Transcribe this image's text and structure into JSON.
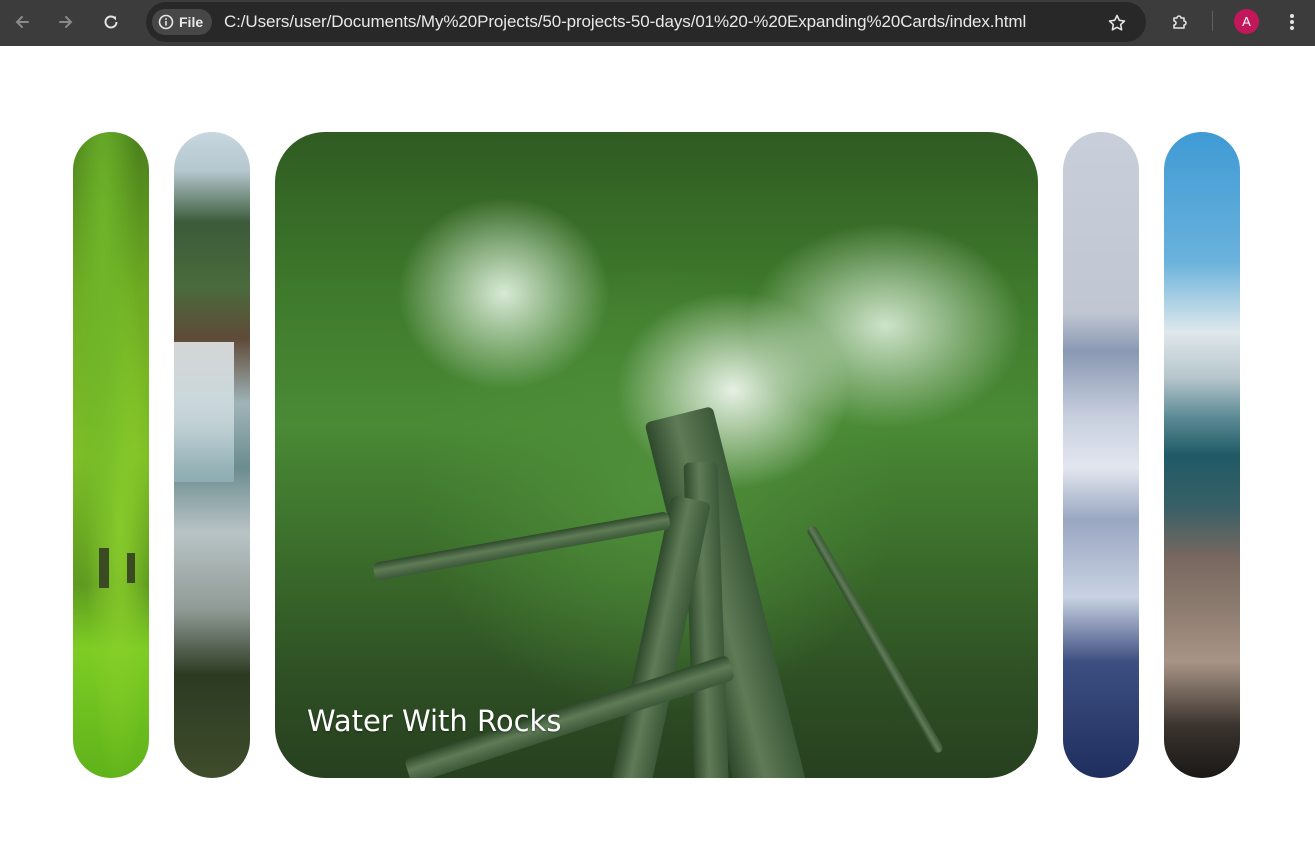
{
  "browser": {
    "file_label": "File",
    "url": "C:/Users/user/Documents/My%20Projects/50-projects-50-days/01%20-%20Expanding%20Cards/index.html",
    "avatar_initial": "A",
    "avatar_color": "#c2185b"
  },
  "panels": [
    {
      "title": "",
      "image": "green-trees",
      "active": false
    },
    {
      "title": "",
      "image": "waterfall",
      "active": false
    },
    {
      "title": "Water With Rocks",
      "image": "bamboo-forest",
      "active": true
    },
    {
      "title": "",
      "image": "snowy-mountain",
      "active": false
    },
    {
      "title": "",
      "image": "ocean-wave",
      "active": false
    }
  ]
}
